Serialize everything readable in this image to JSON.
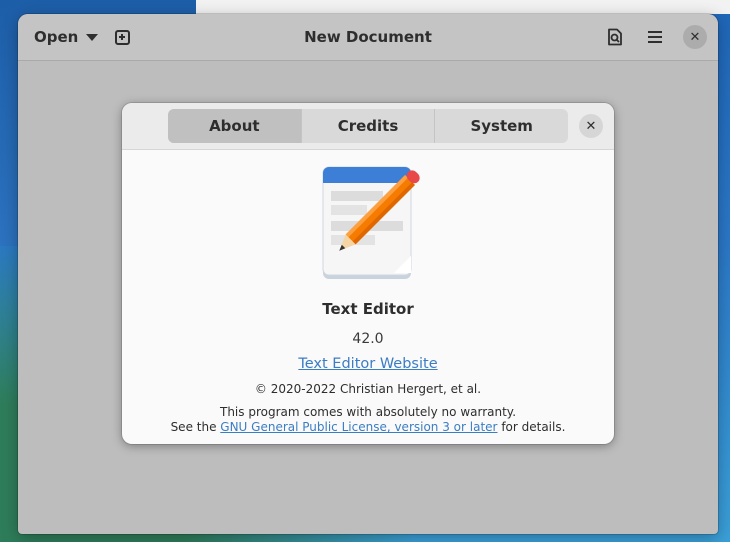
{
  "window": {
    "title": "New Document",
    "open_label": "Open",
    "close_glyph": "✕"
  },
  "dialog": {
    "tabs": [
      {
        "label": "About",
        "active": true
      },
      {
        "label": "Credits",
        "active": false
      },
      {
        "label": "System",
        "active": false
      }
    ],
    "close_glyph": "✕",
    "app_name": "Text Editor",
    "version": "42.0",
    "website_label": "Text Editor Website",
    "copyright": "© 2020-2022 Christian Hergert, et al.",
    "warranty_line1": "This program comes with absolutely no warranty.",
    "warranty_prefix": "See the",
    "license_link": "GNU General Public License, version 3 or later",
    "warranty_suffix": "for details."
  },
  "colors": {
    "accent_link": "#3b7dc4",
    "icon_blue": "#3d7fd6",
    "pencil_orange": "#f57c00"
  },
  "icons": [
    "open-caret-icon",
    "new-tab-icon",
    "document-search-icon",
    "hamburger-menu-icon",
    "close-icon",
    "text-editor-app-icon"
  ]
}
